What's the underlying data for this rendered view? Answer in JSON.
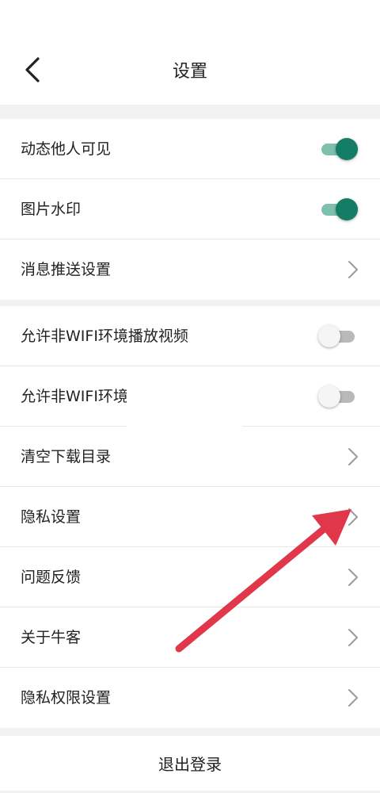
{
  "header": {
    "title": "设置"
  },
  "group1": {
    "items": [
      {
        "label": "动态他人可见",
        "control": "toggle",
        "state": "on"
      },
      {
        "label": "图片水印",
        "control": "toggle",
        "state": "on"
      },
      {
        "label": "消息推送设置",
        "control": "chevron"
      }
    ]
  },
  "group2": {
    "items": [
      {
        "label": "允许非WIFI环境播放视频",
        "control": "toggle",
        "state": "off"
      },
      {
        "label": "允许非WIFI环境",
        "control": "toggle",
        "state": "off"
      },
      {
        "label": "清空下载目录",
        "control": "chevron"
      },
      {
        "label": "隐私设置",
        "control": "chevron"
      },
      {
        "label": "问题反馈",
        "control": "chevron"
      },
      {
        "label": "关于牛客",
        "control": "chevron"
      },
      {
        "label": "隐私权限设置",
        "control": "chevron"
      }
    ]
  },
  "footer": {
    "logout_label": "退出登录"
  },
  "colors": {
    "toggle_on": "#147d66",
    "annotation_arrow": "#e0384a"
  },
  "icons": {
    "back": "chevron-left-icon",
    "row": "chevron-right-icon",
    "annotation": "red-arrow-icon"
  }
}
